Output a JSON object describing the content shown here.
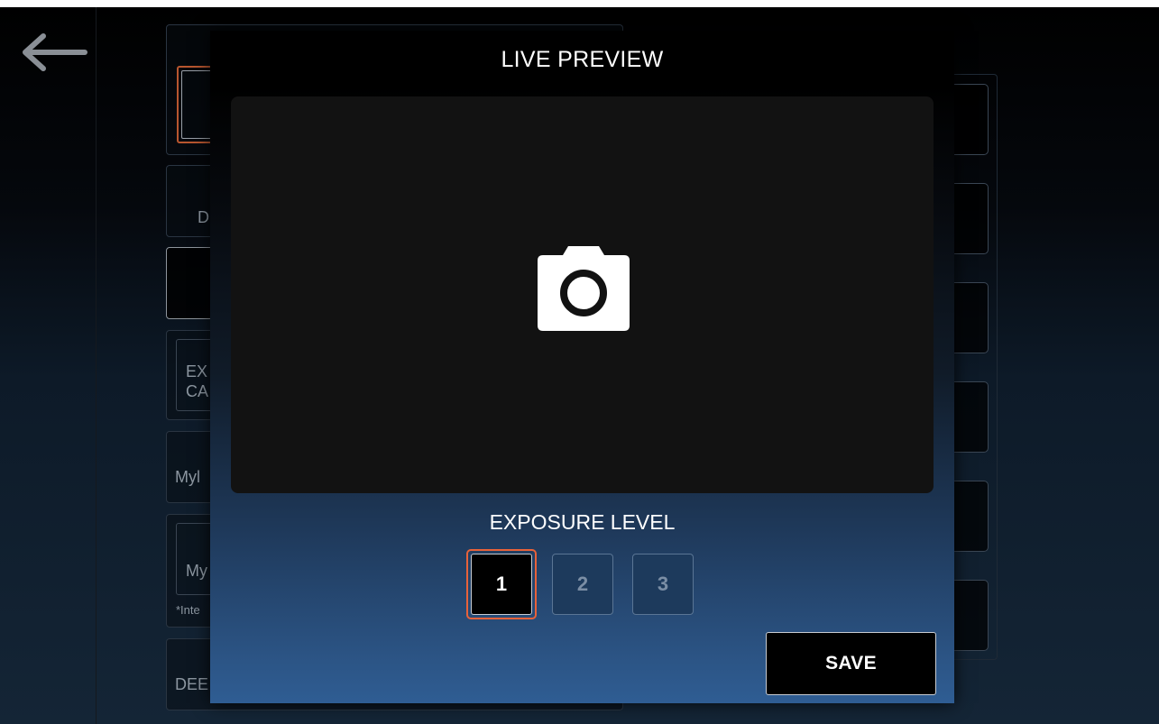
{
  "background_panel": {
    "card2_text": "D",
    "card4_line1": "EX",
    "card4_line2": "CA",
    "card5_text": "Myl",
    "card6_text": "My",
    "card6_note": "*Inte",
    "card7_text": "DEE"
  },
  "modal": {
    "title": "LIVE PREVIEW",
    "preview_icon": "camera-icon",
    "exposure_label": "EXPOSURE LEVEL",
    "levels": [
      {
        "label": "1",
        "selected": true
      },
      {
        "label": "2",
        "selected": false
      },
      {
        "label": "3",
        "selected": false
      }
    ],
    "save_label": "SAVE"
  },
  "colors": {
    "accent": "#e8623a",
    "modal_gradient_bottom": "#2f5d93",
    "preview_bg": "#121212"
  },
  "icons": {
    "back": "back-arrow-icon",
    "camera": "camera-icon"
  }
}
